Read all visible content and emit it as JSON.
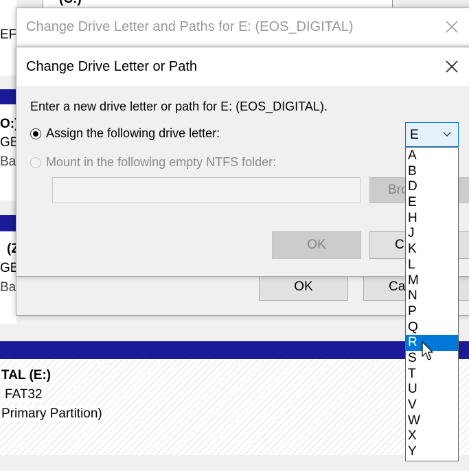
{
  "background": {
    "top_partition_label": "(C:)",
    "efi_label": "EFI",
    "disk_rows": [
      {
        "name": "O:)",
        "size": "GB",
        "type": "Bas"
      },
      {
        "name": "(Z",
        "size": "GB",
        "type": "Bas"
      }
    ],
    "volume": {
      "name": "TAL  (E:)",
      "fs": "FAT32",
      "status": "Primary Partition)"
    }
  },
  "outer_dialog": {
    "title": "Change Drive Letter and Paths for E: (EOS_DIGITAL)",
    "ok_label": "OK",
    "cancel_label": "Ca"
  },
  "inner_dialog": {
    "title": "Change Drive Letter or Path",
    "instruction": "Enter a new drive letter or path for E: (EOS_DIGITAL).",
    "assign_label": "Assign the following drive letter:",
    "mount_label": "Mount in the following empty NTFS folder:",
    "browse_label": "Bro",
    "ok_label": "OK",
    "cancel_label": "C"
  },
  "dropdown": {
    "selected": "E",
    "highlighted": "R",
    "options": [
      "A",
      "B",
      "D",
      "E",
      "H",
      "J",
      "K",
      "L",
      "M",
      "N",
      "P",
      "Q",
      "R",
      "S",
      "T",
      "U",
      "V",
      "W",
      "X",
      "Y"
    ]
  },
  "icons": {
    "close": "close-icon",
    "chevron": "chevron-down-icon",
    "cursor": "mouse-pointer-icon"
  },
  "colors": {
    "accent": "#0078d7",
    "disk_header": "#1b1b9a"
  }
}
